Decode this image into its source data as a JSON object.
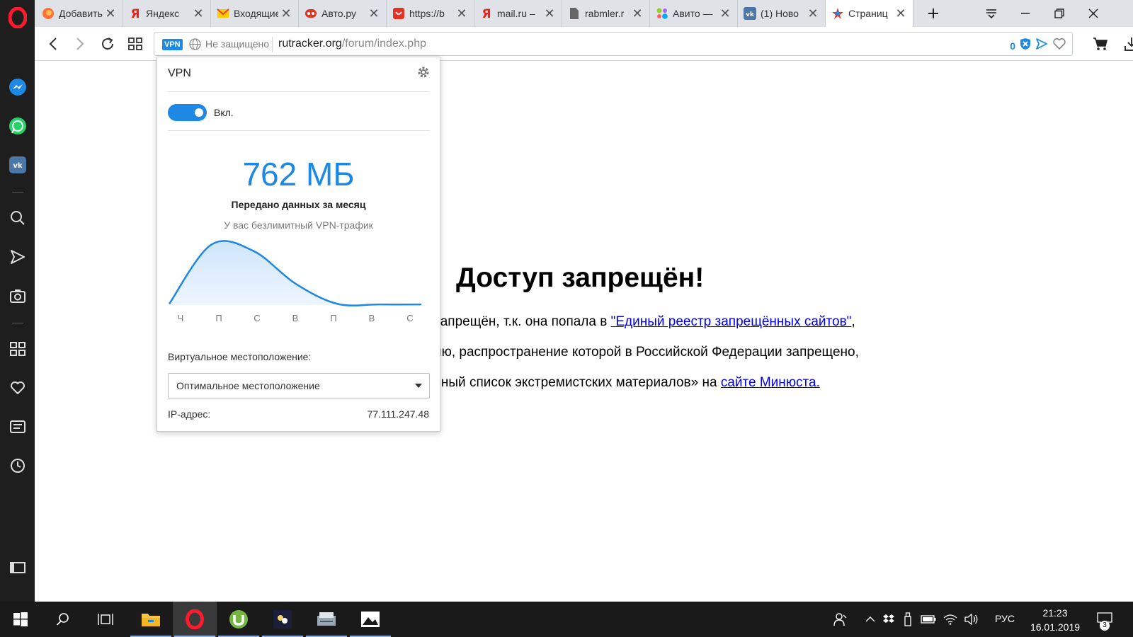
{
  "tabs": [
    {
      "title": "Добавить",
      "icon": "firefox-icon"
    },
    {
      "title": "Яндекс",
      "icon": "yandex-icon"
    },
    {
      "title": "Входящие",
      "icon": "mail-envelope-icon"
    },
    {
      "title": "Авто.ру",
      "icon": "auto-ru-icon"
    },
    {
      "title": "https://b",
      "icon": "aliexpress-icon"
    },
    {
      "title": "mail.ru –",
      "icon": "yandex-icon"
    },
    {
      "title": "rabmler.r",
      "icon": "document-icon"
    },
    {
      "title": "Авито —",
      "icon": "avito-icon"
    },
    {
      "title": "(1) Ново",
      "icon": "vk-icon"
    },
    {
      "title": "Страниц",
      "icon": "rkn-icon",
      "active": true
    }
  ],
  "address": {
    "vpn_badge": "VPN",
    "security": "Не защищено",
    "host": "rutracker.org",
    "path": "/forum/index.php",
    "blocked_count": "0"
  },
  "page": {
    "heading": "Доступ запрещён!",
    "line1_text": "запрещён, т.к. она попала в ",
    "line1_link": "\"Единый реестр запрещённых сайтов\"",
    "line1_tail": ",",
    "line2_text": "ию, распространение которой в Российской Федерации запрещено,",
    "line3_text": "ьный список экстремистских материалов» на ",
    "line3_link": "сайте Минюста."
  },
  "vpn": {
    "title": "VPN",
    "toggle_label": "Вкл.",
    "enabled": true,
    "amount": "762 МБ",
    "caption": "Передано данных за месяц",
    "subcaption": "У вас безлимитный VPN-трафик",
    "location_label": "Виртуальное местоположение:",
    "location_value": "Оптимальное местоположение",
    "ip_label": "IP-адрес:",
    "ip_value": "77.111.247.48",
    "accent_color": "#1e88e5"
  },
  "chart_data": {
    "type": "area",
    "categories": [
      "Ч",
      "П",
      "С",
      "В",
      "П",
      "В",
      "С"
    ],
    "values": [
      0.02,
      0.98,
      0.88,
      0.35,
      0.02,
      0.01,
      0.01
    ],
    "title": "",
    "xlabel": "",
    "ylabel": ""
  },
  "taskbar": {
    "time": "21:23",
    "date": "16.01.2019",
    "lang": "РУС",
    "notifications": "3",
    "apps": [
      "start-windows-icon",
      "search-icon",
      "task-view-icon",
      "file-explorer-icon",
      "opera-icon",
      "utorrent-icon",
      "winamp-icon",
      "scanner-app-icon",
      "photos-icon"
    ]
  }
}
